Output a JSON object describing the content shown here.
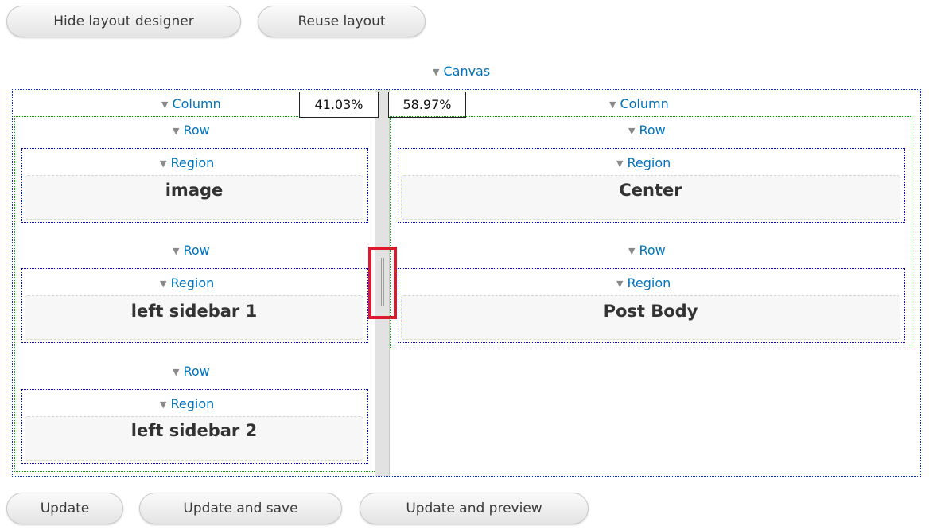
{
  "toolbar": {
    "hide_designer_label": "Hide layout designer",
    "reuse_layout_label": "Reuse layout"
  },
  "canvas": {
    "label": "Canvas",
    "columns": [
      {
        "label": "Column",
        "width_percent": "41.03%",
        "rows": [
          {
            "label": "Row",
            "region_label": "Region",
            "region_name": "image"
          },
          {
            "label": "Row",
            "region_label": "Region",
            "region_name": "left sidebar 1"
          },
          {
            "label": "Row",
            "region_label": "Region",
            "region_name": "left sidebar 2"
          }
        ]
      },
      {
        "label": "Column",
        "width_percent": "58.97%",
        "rows": [
          {
            "label": "Row",
            "region_label": "Region",
            "region_name": "Center"
          },
          {
            "label": "Row",
            "region_label": "Region",
            "region_name": "Post Body"
          }
        ]
      }
    ]
  },
  "actions": {
    "update_label": "Update",
    "update_save_label": "Update and save",
    "update_preview_label": "Update and preview"
  },
  "colors": {
    "link": "#0074bd",
    "canvas_border": "#0033cc",
    "column_border": "#00aa00",
    "region_border": "#0000cc",
    "splitter_highlight": "#e0182d"
  },
  "icons": {
    "toggle": "triangle-down-icon",
    "splitter_grip": "grip-icon"
  }
}
